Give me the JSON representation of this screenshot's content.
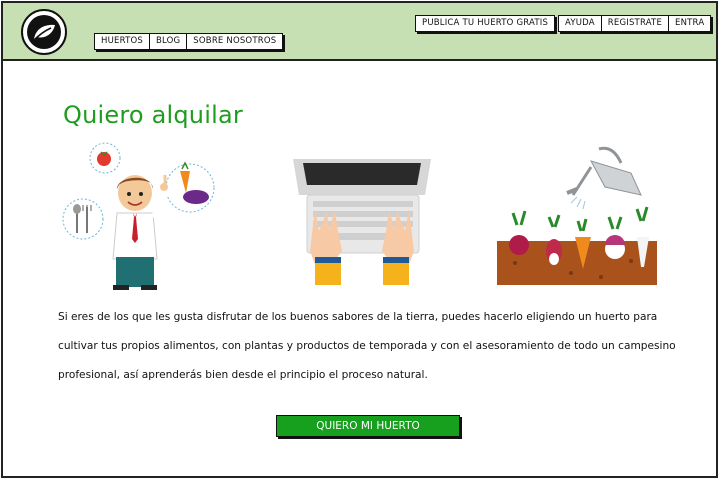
{
  "header": {
    "logo_icon": "leaf-icon",
    "nav": [
      "HUERTOS",
      "BLOG",
      "SOBRE NOSOTROS"
    ],
    "publish_label": "PUBLICA TU HUERTO GRATIS",
    "help_label": "AYUDA",
    "register_label": "REGISTRATE",
    "login_label": "ENTRA",
    "background_color": "#c6e0b4"
  },
  "main": {
    "title": "Quiero alquilar",
    "title_color": "#1e9e1e",
    "paragraph": "Si eres de los que les gusta disfrutar de los buenos sabores de la tierra, puedes hacerlo eligiendo un huerto para cultivar tus propios alimentos, con plantas y productos de temporada y con el asesoramiento de todo un campesino profesional, así aprenderás bien desde el principio el proceso natural.",
    "cta_label": "QUIERO MI HUERTO",
    "cta_color": "#16a01e",
    "illustrations": [
      "man-thinking-about-produce-icon",
      "laptop-typing-icon",
      "vegetable-garden-icon"
    ]
  }
}
